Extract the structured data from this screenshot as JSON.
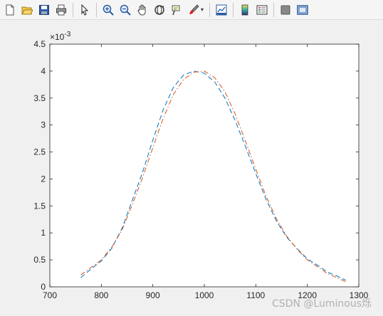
{
  "toolbar": {
    "buttons": [
      {
        "name": "new-figure-icon"
      },
      {
        "name": "open-file-icon"
      },
      {
        "name": "save-icon"
      },
      {
        "name": "print-icon"
      },
      {
        "sep": true
      },
      {
        "name": "pointer-icon"
      },
      {
        "sep": true
      },
      {
        "name": "zoom-in-icon"
      },
      {
        "name": "zoom-out-icon"
      },
      {
        "name": "pan-hand-icon"
      },
      {
        "name": "rotate-3d-icon"
      },
      {
        "name": "data-cursor-icon"
      },
      {
        "name": "brush-icon"
      },
      {
        "sep": true
      },
      {
        "name": "link-plot-icon"
      },
      {
        "sep": true
      },
      {
        "name": "colorbar-icon"
      },
      {
        "name": "legend-icon"
      },
      {
        "sep": true
      },
      {
        "name": "hide-plot-tools-icon"
      },
      {
        "name": "show-plot-tools-icon"
      }
    ]
  },
  "watermark": "CSDN @Luminous烁",
  "chart_data": {
    "type": "line",
    "title": "",
    "xlabel": "",
    "ylabel": "",
    "xlim": [
      700,
      1300
    ],
    "ylim": [
      0,
      4.5
    ],
    "x_ticks": [
      700,
      800,
      900,
      1000,
      1100,
      1200,
      1300
    ],
    "y_ticks": [
      0,
      0.5,
      1,
      1.5,
      2,
      2.5,
      3,
      3.5,
      4,
      4.5
    ],
    "y_tick_labels": [
      "0",
      "0.5",
      "1",
      "1.5",
      "2",
      "2.5",
      "3",
      "3.5",
      "4",
      "4.5"
    ],
    "y_exponent_label": "×10",
    "y_exponent_power": "-3",
    "grid": false,
    "series": [
      {
        "color": "#0072bd",
        "dash": "dashed",
        "x": [
          760,
          780,
          800,
          820,
          840,
          860,
          880,
          900,
          920,
          940,
          960,
          980,
          1000,
          1020,
          1040,
          1060,
          1080,
          1100,
          1120,
          1140,
          1160,
          1180,
          1200,
          1220,
          1240,
          1260,
          1275
        ],
        "y": [
          0.17,
          0.33,
          0.48,
          0.71,
          1.08,
          1.6,
          2.12,
          2.72,
          3.28,
          3.7,
          3.93,
          4.0,
          3.96,
          3.8,
          3.5,
          3.08,
          2.6,
          2.1,
          1.62,
          1.22,
          0.92,
          0.71,
          0.52,
          0.4,
          0.27,
          0.19,
          0.12
        ]
      },
      {
        "color": "#d95319",
        "dash": "dashdot",
        "x": [
          760,
          780,
          800,
          820,
          840,
          860,
          880,
          900,
          920,
          940,
          960,
          980,
          1000,
          1020,
          1040,
          1060,
          1080,
          1100,
          1120,
          1140,
          1160,
          1180,
          1200,
          1220,
          1240,
          1260,
          1275
        ],
        "y": [
          0.22,
          0.36,
          0.5,
          0.73,
          1.05,
          1.52,
          2.02,
          2.58,
          3.12,
          3.57,
          3.85,
          3.98,
          4.0,
          3.88,
          3.62,
          3.2,
          2.7,
          2.18,
          1.68,
          1.26,
          0.94,
          0.7,
          0.5,
          0.37,
          0.24,
          0.16,
          0.09
        ]
      }
    ]
  }
}
